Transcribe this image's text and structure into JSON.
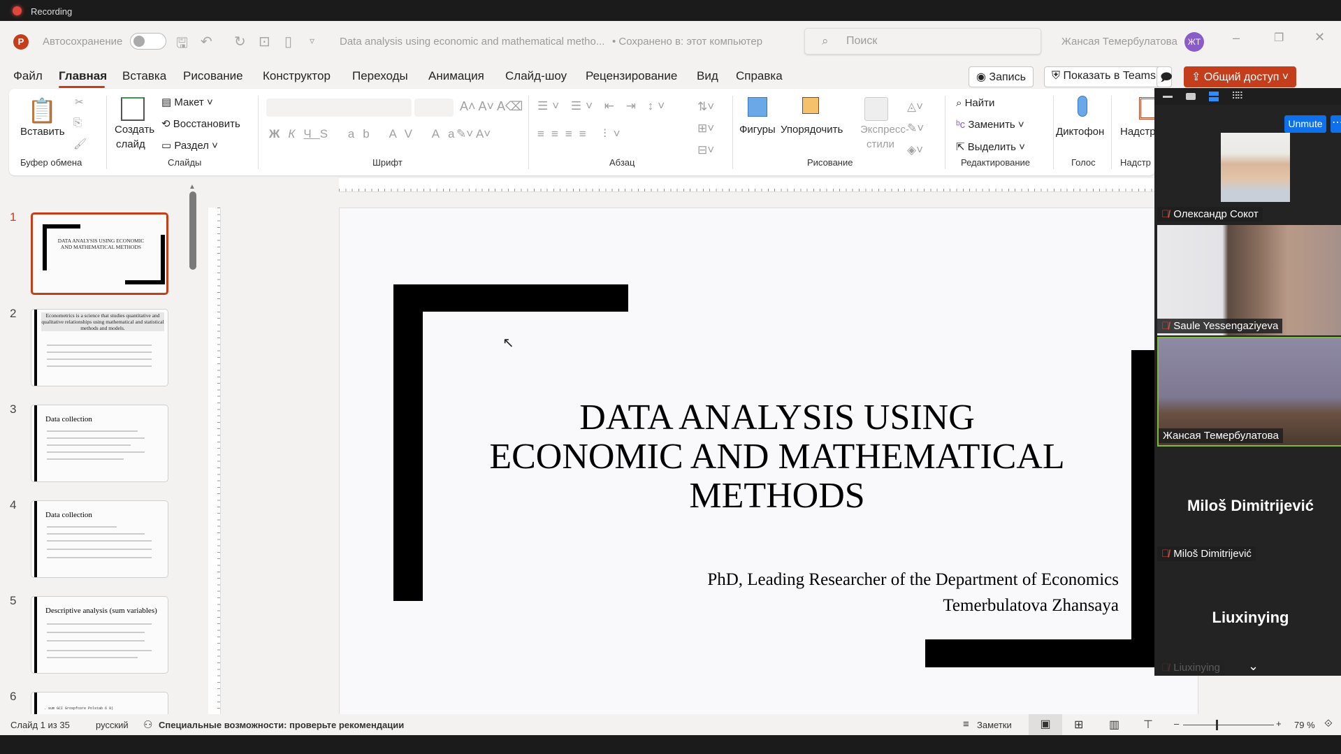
{
  "recording": {
    "label": "Recording"
  },
  "titlebar": {
    "autosave": "Автосохранение",
    "doc_title": "Data analysis using economic and mathematical metho...",
    "saved": "• Сохранено в: этот компьютер",
    "search_placeholder": "Поиск",
    "user": "Жансая Темербулатова",
    "initials": "ЖТ"
  },
  "menu": {
    "tabs": [
      "Файл",
      "Главная",
      "Вставка",
      "Рисование",
      "Конструктор",
      "Переходы",
      "Анимация",
      "Слайд-шоу",
      "Рецензирование",
      "Вид",
      "Справка"
    ],
    "record": "Запись",
    "teams": "Показать в Teams",
    "share": "Общий доступ"
  },
  "ribbon": {
    "paste": "Вставить",
    "clipboard": "Буфер обмена",
    "new_slide_1": "Создать",
    "new_slide_2": "слайд",
    "layout": "Макет",
    "reset": "Восстановить",
    "section": "Раздел",
    "slides": "Слайды",
    "font": "Шрифт",
    "paragraph": "Абзац",
    "shapes": "Фигуры",
    "arrange": "Упорядочить",
    "quick_styles_1": "Экспресс-",
    "quick_styles_2": "стили",
    "drawing": "Рисование",
    "find": "Найти",
    "replace": "Заменить",
    "select": "Выделить",
    "editing": "Редактирование",
    "dictate": "Диктофон",
    "voice": "Голос",
    "addins": "Надстр"
  },
  "thumbnails": [
    {
      "n": "1",
      "title": "DATA ANALYSIS USING ECONOMIC AND MATHEMATICAL METHODS"
    },
    {
      "n": "2",
      "title": "Econometrics is a science that studies quantitative and qualitative relationships using mathematical and statistical methods and models."
    },
    {
      "n": "3",
      "title": "Data collection"
    },
    {
      "n": "4",
      "title": "Data collection"
    },
    {
      "n": "5",
      "title": "Descriptive analysis (sum variables)"
    },
    {
      "n": "6",
      "title": ". sum GCI Grospfcore Polstab 6 9)"
    }
  ],
  "slide": {
    "title_1": "DATA ANALYSIS USING",
    "title_2": "ECONOMIC AND MATHEMATICAL",
    "title_3": "METHODS",
    "subtitle_1": "PhD, Leading Researcher of the Department of Economics",
    "subtitle_2": "Temerbulatova Zhansaya"
  },
  "status": {
    "slide": "Слайд 1 из 35",
    "lang": "русский",
    "accessibility": "Специальные возможности: проверьте рекомендации",
    "notes": "Заметки",
    "zoom": "79 %"
  },
  "zoom_meeting": {
    "unmute": "Unmute",
    "participants": [
      {
        "name": "Олександр Сокот",
        "muted": true
      },
      {
        "name": "Saule Yessengaziyeva",
        "muted": true
      },
      {
        "name": "Жансая Темербулатова",
        "muted": false
      },
      {
        "name": "Miloš Dimitrijević",
        "muted": true
      },
      {
        "name": "Liuxinying",
        "muted": true
      }
    ]
  },
  "colors": {
    "accent": "#c43e1c",
    "zoom_blue": "#0e71eb",
    "avatar": "#8a5cc7"
  }
}
